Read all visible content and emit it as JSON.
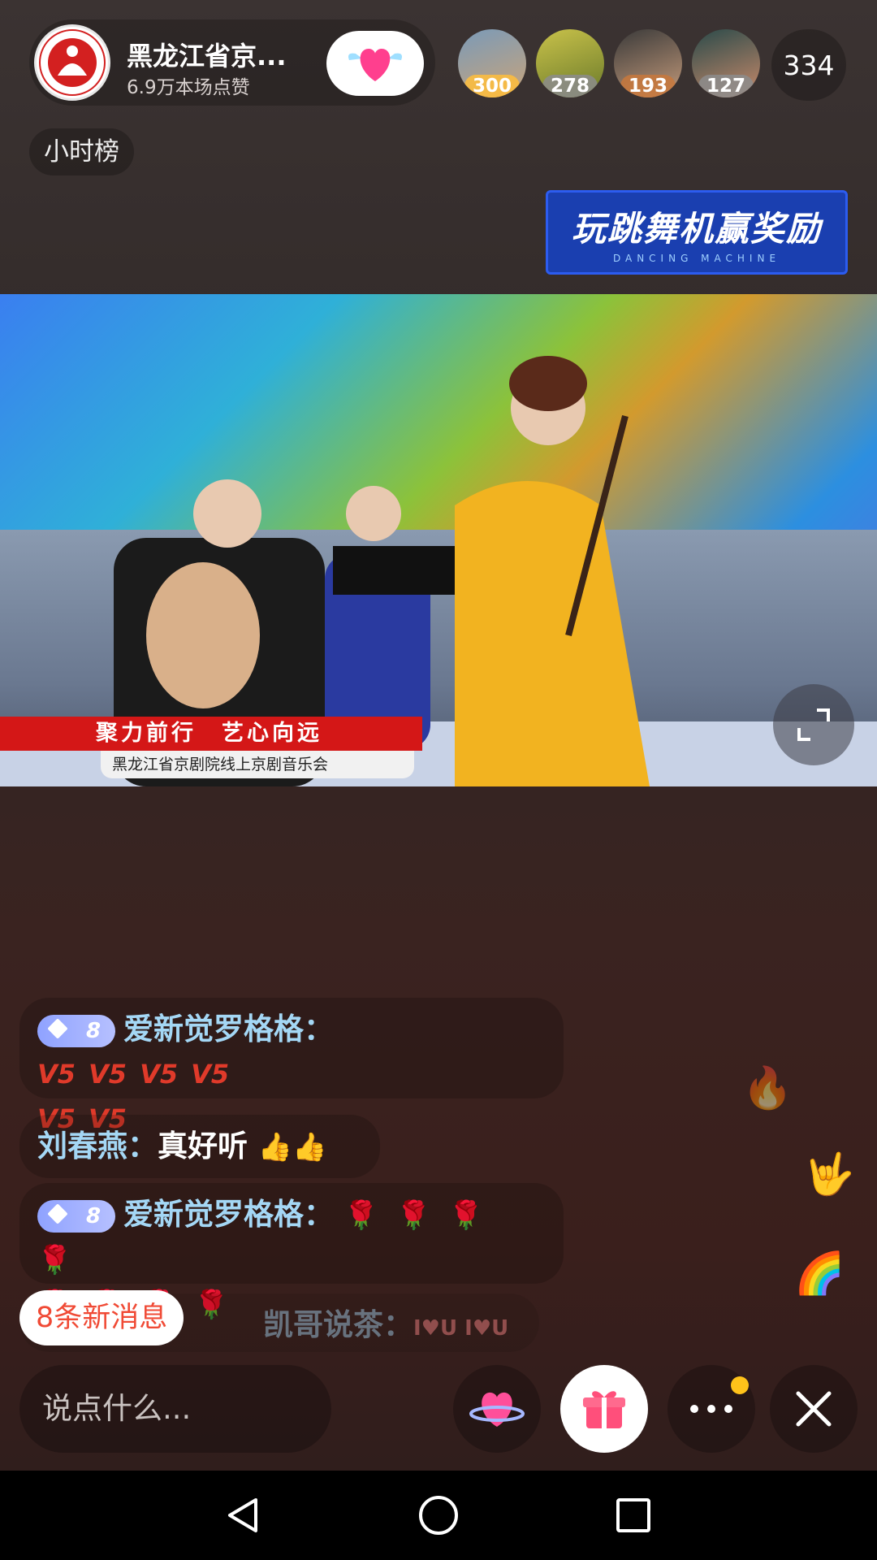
{
  "anchor": {
    "name": "黑龙江省京...",
    "likes": "6.9万本场点赞"
  },
  "top_viewers": [
    {
      "score": "300"
    },
    {
      "score": "278"
    },
    {
      "score": "193"
    },
    {
      "score": "127"
    }
  ],
  "viewer_count": "334",
  "hour_rank": "小时榜",
  "promo": {
    "title": "玩跳舞机赢奖励",
    "subtitle": "DANCING MACHINE"
  },
  "video": {
    "caption": "聚力前行　艺心向远",
    "subtitle": "黑龙江省京剧院线上京剧音乐会"
  },
  "chat": [
    {
      "level": "8",
      "user": "爱新觉罗格格",
      "sep": "：",
      "text": ""
    },
    {
      "level": "",
      "user": "刘春燕",
      "sep": "：",
      "text": "真好听"
    },
    {
      "level": "8",
      "user": "爱新觉罗格格",
      "sep": "：",
      "text": ""
    },
    {
      "level": "",
      "user": "凯哥说茶",
      "sep": "：",
      "text": "I♥U I♥U"
    }
  ],
  "new_messages": "8条新消息",
  "input_placeholder": "说点什么...",
  "colors": {
    "accent_red": "#f04a35",
    "username_blue": "#a4d7f5",
    "badge_purple": "#8fa2ff"
  }
}
